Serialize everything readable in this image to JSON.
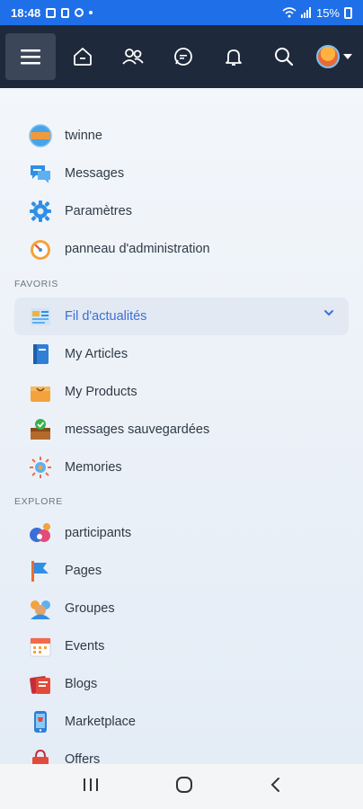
{
  "status_bar": {
    "time": "18:48",
    "battery": "15%"
  },
  "menu": {
    "main": [
      {
        "label": "twinne",
        "icon": "profile-avatar-icon"
      },
      {
        "label": "Messages",
        "icon": "chat-bubbles-icon"
      },
      {
        "label": "Paramètres",
        "icon": "gear-icon"
      },
      {
        "label": "panneau d'administration",
        "icon": "speedometer-icon"
      }
    ],
    "favoris_title": "FAVORIS",
    "favoris": [
      {
        "label": "Fil d'actualités",
        "icon": "newsfeed-icon"
      },
      {
        "label": "My Articles",
        "icon": "notebook-icon"
      },
      {
        "label": "My Products",
        "icon": "shopping-bag-icon"
      },
      {
        "label": "messages sauvegardées",
        "icon": "saved-box-icon"
      },
      {
        "label": "Memories",
        "icon": "memories-icon"
      }
    ],
    "explore_title": "EXPLORE",
    "explore": [
      {
        "label": "participants",
        "icon": "participants-icon"
      },
      {
        "label": "Pages",
        "icon": "flag-icon"
      },
      {
        "label": "Groupes",
        "icon": "groups-icon"
      },
      {
        "label": "Events",
        "icon": "calendar-icon"
      },
      {
        "label": "Blogs",
        "icon": "blog-icon"
      },
      {
        "label": "Marketplace",
        "icon": "marketplace-phone-icon"
      },
      {
        "label": "Offers",
        "icon": "offers-icon"
      }
    ]
  },
  "colors": {
    "status_bar": "#1f6fe8",
    "topnav": "#1e2a3b",
    "active_text": "#3b6fd8"
  }
}
